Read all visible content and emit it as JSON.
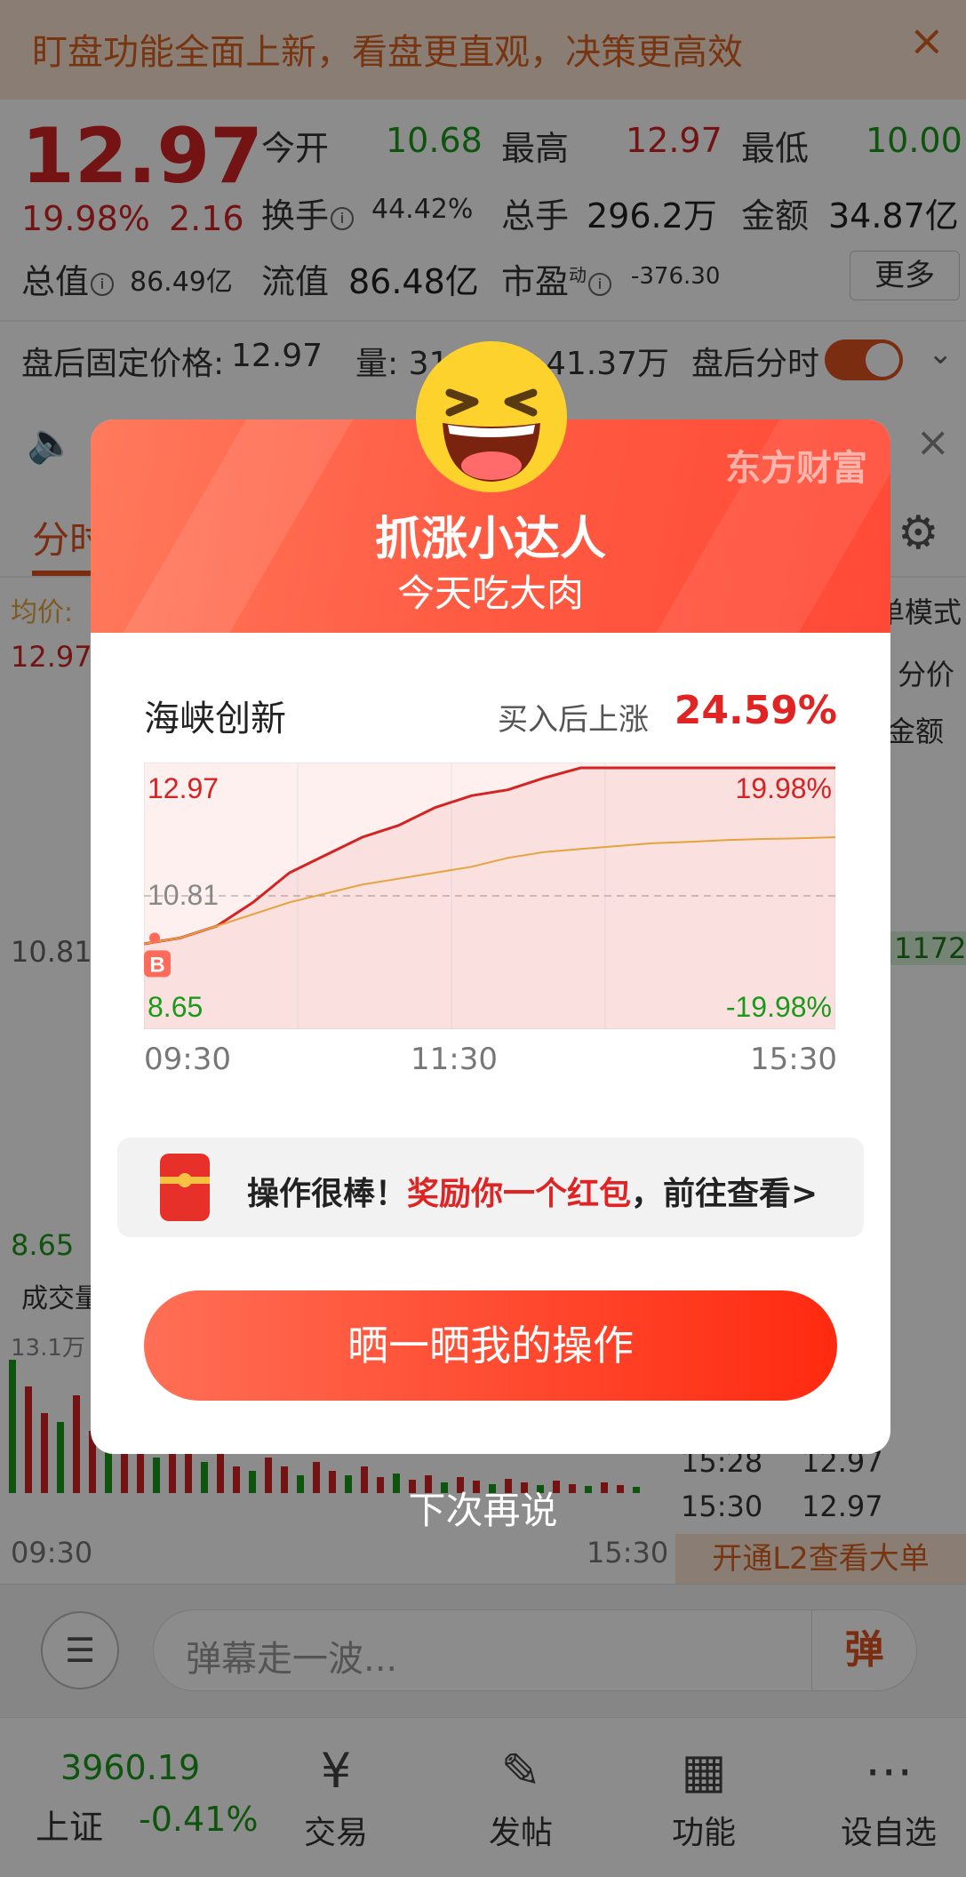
{
  "banner": {
    "text": "盯盘功能全面上新，看盘更直观，决策更高效",
    "close_icon": "×"
  },
  "quote": {
    "price": "12.97",
    "change_pct": "19.98%",
    "change_amt": "2.16",
    "open_label": "今开",
    "open_value": "10.68",
    "high_label": "最高",
    "high_value": "12.97",
    "low_label": "最低",
    "low_value": "10.00",
    "turnover_label": "换手",
    "turnover_value": "44.42%",
    "volume_label": "总手",
    "volume_value": "296.2万",
    "amount_label": "金额",
    "amount_value": "34.87亿",
    "mktcap_label": "总值",
    "mktcap_value": "86.49亿",
    "float_label": "流值",
    "float_value": "86.48亿",
    "pe_label": "市盈",
    "pe_superscript": "动",
    "pe_value": "-376.30",
    "more_button": "更多"
  },
  "after_hours": {
    "price_label": "盘后固定价格:",
    "price_value": "12.97",
    "volume_label": "量: 31",
    "amount_value": "41.37万",
    "timeshare_label": "盘后分时"
  },
  "tabs": {
    "active": "分时"
  },
  "chart_bg": {
    "avg_label": "均价:",
    "high": "12.97",
    "mid": "10.81",
    "low": "8.65",
    "volume_label": "成交量",
    "vol_max": "13.1万",
    "start_time": "09:30",
    "end_time": "15:30"
  },
  "side_panel": {
    "mode": "单模式",
    "col1": "分价",
    "col2": "金额",
    "highlight": "1172",
    "rows": [
      {
        "time": "15:28",
        "price": "12.97"
      },
      {
        "time": "15:30",
        "price": "12.97"
      }
    ],
    "l2_button": "开通L2查看大单"
  },
  "danmu": {
    "placeholder": "弹幕走一波...",
    "send_label": "弹"
  },
  "bottom_nav": {
    "index_value": "3960.19",
    "index_name": "上证",
    "index_pct": "-0.41%",
    "items": [
      {
        "label": "交易",
        "icon": "¥"
      },
      {
        "label": "发帖",
        "icon": "✎"
      },
      {
        "label": "功能",
        "icon": "▦"
      },
      {
        "label": "设自选",
        "icon": "⋯"
      }
    ]
  },
  "modal": {
    "brand": "东方财富",
    "title": "抓涨小达人",
    "subtitle": "今天吃大肉",
    "stock_name": "海峡创新",
    "gain_label": "买入后上涨",
    "gain_value": "24.59%",
    "reward_prefix": "操作很棒！",
    "reward_highlight": "奖励你一个红包",
    "reward_suffix": "，前往查看>",
    "share_button": "晒一晒我的操作",
    "later_button": "下次再说"
  },
  "chart_data": {
    "type": "line",
    "title": "",
    "x": [
      "09:30",
      "11:30",
      "15:30"
    ],
    "ylim": [
      8.65,
      12.97
    ],
    "reference_value": 10.81,
    "y_tick_labels_left": [
      "12.97",
      "10.81",
      "8.65"
    ],
    "y_tick_labels_right": [
      "19.98%",
      "-19.98%"
    ],
    "buy_marker": {
      "label": "B",
      "time": "09:30",
      "price": 10.1
    },
    "series": [
      {
        "color": "#d42323",
        "values": [
          10.0,
          10.1,
          10.3,
          10.7,
          11.2,
          11.5,
          11.8,
          12.0,
          12.3,
          12.5,
          12.6,
          12.8,
          12.97,
          12.97,
          12.97,
          12.97,
          12.97,
          12.97,
          12.97,
          12.97
        ]
      },
      {
        "color": "#e6a33c",
        "values": [
          10.0,
          10.1,
          10.3,
          10.5,
          10.7,
          10.85,
          11.0,
          11.1,
          11.2,
          11.3,
          11.45,
          11.55,
          11.6,
          11.65,
          11.7,
          11.72,
          11.75,
          11.77,
          11.78,
          11.8
        ]
      }
    ]
  }
}
